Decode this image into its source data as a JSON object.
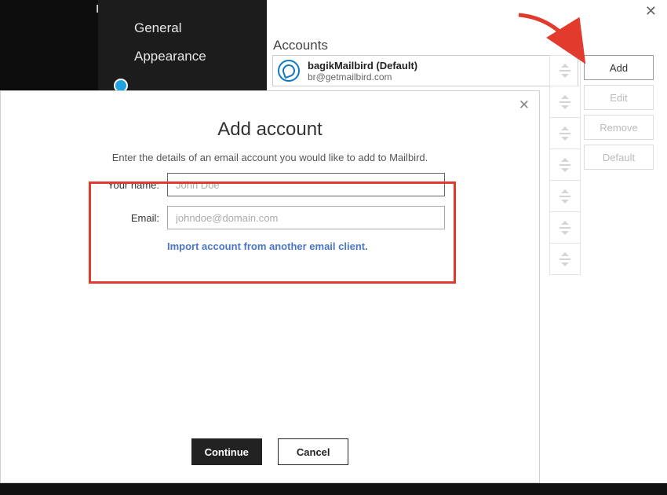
{
  "sidebar": {
    "top_fragment": "In",
    "items": [
      "General",
      "Appearance"
    ]
  },
  "main": {
    "header": "Accounts",
    "account": {
      "name": "bagikMailbird (Default)",
      "email": "br@getmailbird.com"
    },
    "buttons": {
      "add": "Add",
      "edit": "Edit",
      "remove": "Remove",
      "default": "Default"
    }
  },
  "modal": {
    "title": "Add account",
    "subtitle": "Enter the details of an email account you would like to add to Mailbird.",
    "labels": {
      "name": "Your name:",
      "email": "Email:"
    },
    "placeholders": {
      "name": "John Doe",
      "email": "johndoe@domain.com"
    },
    "import_link": "Import account from another email client.",
    "continue": "Continue",
    "cancel": "Cancel"
  }
}
